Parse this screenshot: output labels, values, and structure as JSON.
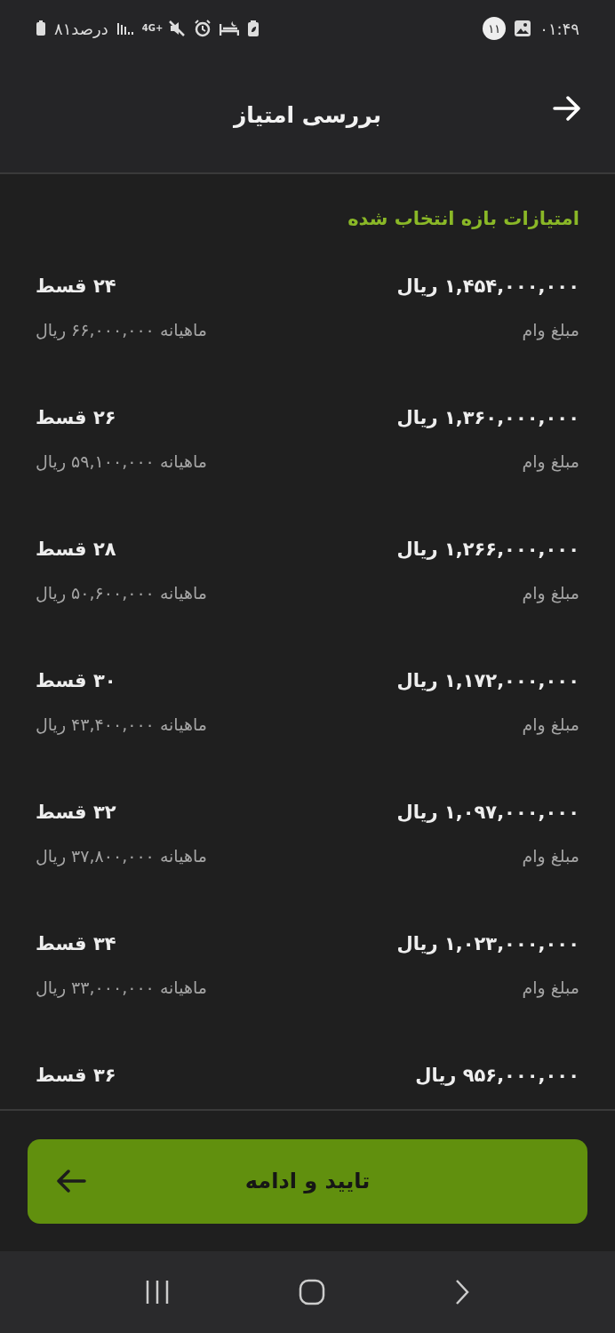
{
  "status_bar": {
    "time": "۰۱:۴۹",
    "notification_count": "۱۱",
    "battery": "۸۱درصد",
    "network": "4G+"
  },
  "header": {
    "title": "بررسی امتیاز"
  },
  "section_title": "امتیازات بازه انتخاب شده",
  "options": [
    {
      "amount": "۱,۴۵۴,۰۰۰,۰۰۰ ریال",
      "installments": "۲۴ قسط",
      "amount_label": "مبلغ وام",
      "monthly": "ماهیانه ۶۶,۰۰۰,۰۰۰ ریال"
    },
    {
      "amount": "۱,۳۶۰,۰۰۰,۰۰۰ ریال",
      "installments": "۲۶ قسط",
      "amount_label": "مبلغ وام",
      "monthly": "ماهیانه ۵۹,۱۰۰,۰۰۰ ریال"
    },
    {
      "amount": "۱,۲۶۶,۰۰۰,۰۰۰ ریال",
      "installments": "۲۸ قسط",
      "amount_label": "مبلغ وام",
      "monthly": "ماهیانه ۵۰,۶۰۰,۰۰۰ ریال"
    },
    {
      "amount": "۱,۱۷۲,۰۰۰,۰۰۰ ریال",
      "installments": "۳۰ قسط",
      "amount_label": "مبلغ وام",
      "monthly": "ماهیانه ۴۳,۴۰۰,۰۰۰ ریال"
    },
    {
      "amount": "۱,۰۹۷,۰۰۰,۰۰۰ ریال",
      "installments": "۳۲ قسط",
      "amount_label": "مبلغ وام",
      "monthly": "ماهیانه ۳۷,۸۰۰,۰۰۰ ریال"
    },
    {
      "amount": "۱,۰۲۳,۰۰۰,۰۰۰ ریال",
      "installments": "۳۴ قسط",
      "amount_label": "مبلغ وام",
      "monthly": "ماهیانه ۳۳,۰۰۰,۰۰۰ ریال"
    },
    {
      "amount": "۹۵۶,۰۰۰,۰۰۰ ریال",
      "installments": "۳۶ قسط"
    }
  ],
  "confirm_button": {
    "label": "تایید و ادامه"
  }
}
